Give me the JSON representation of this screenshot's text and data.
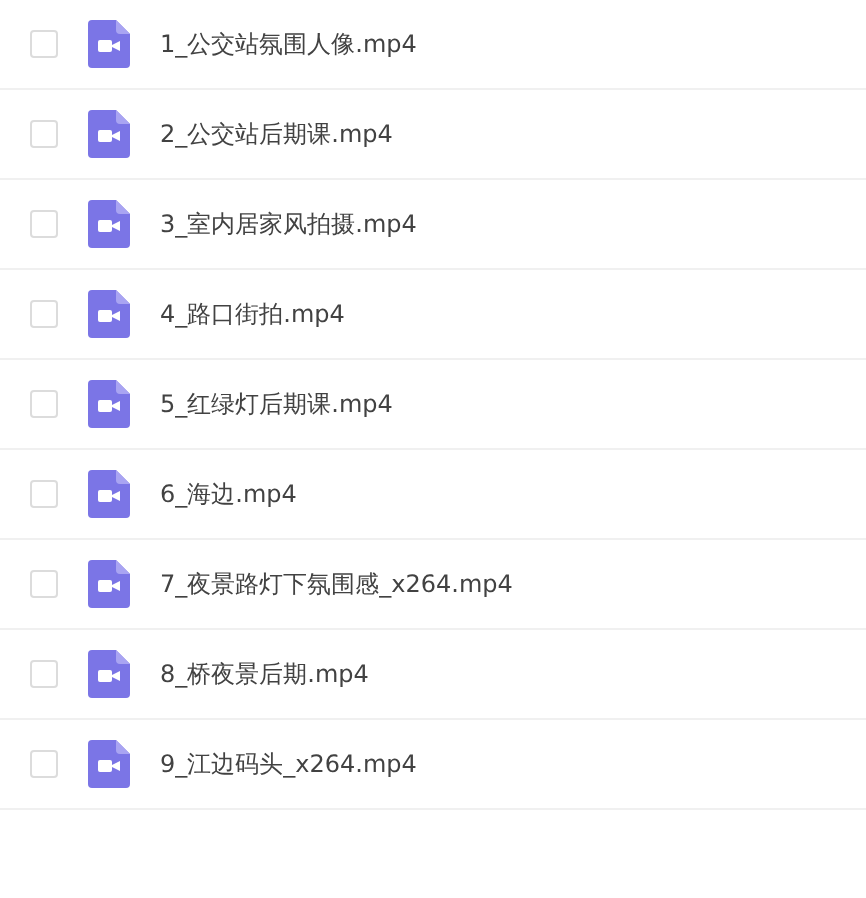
{
  "files": [
    {
      "name": "1_公交站氛围人像.mp4",
      "checked": false
    },
    {
      "name": "2_公交站后期课.mp4",
      "checked": false
    },
    {
      "name": "3_室内居家风拍摄.mp4",
      "checked": false
    },
    {
      "name": "4_路口街拍.mp4",
      "checked": false
    },
    {
      "name": "5_红绿灯后期课.mp4",
      "checked": false
    },
    {
      "name": "6_海边.mp4",
      "checked": false
    },
    {
      "name": "7_夜景路灯下氛围感_x264.mp4",
      "checked": false
    },
    {
      "name": "8_桥夜景后期.mp4",
      "checked": false
    },
    {
      "name": "9_江边码头_x264.mp4",
      "checked": false
    }
  ]
}
